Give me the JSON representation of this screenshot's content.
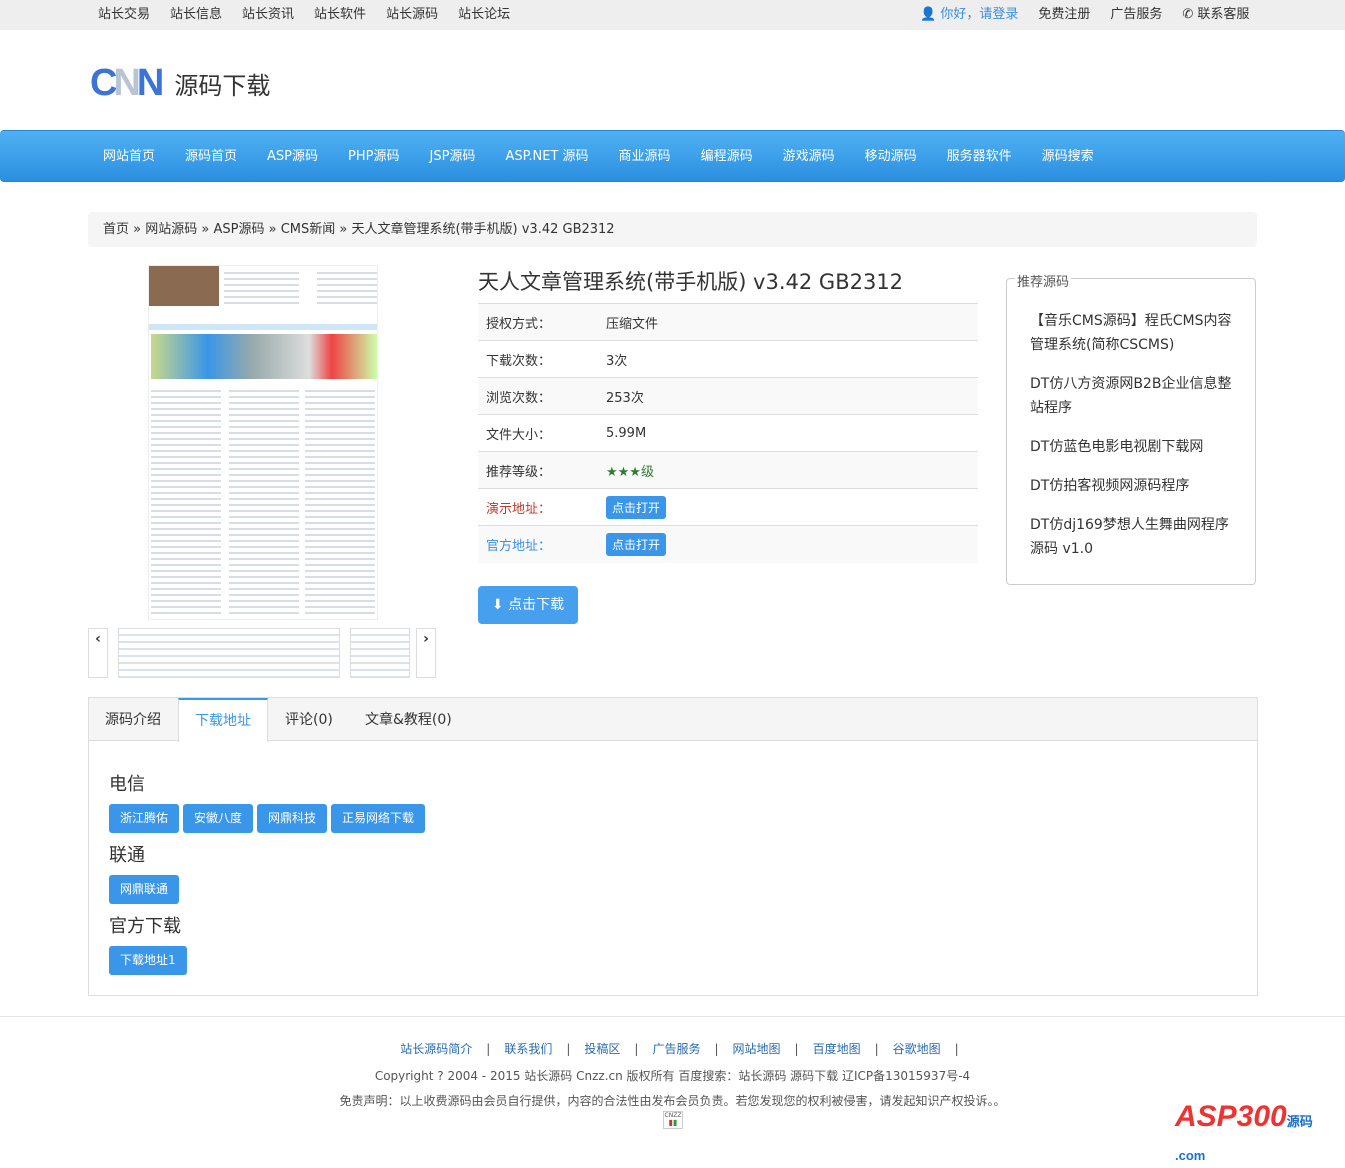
{
  "topbar": {
    "links": [
      "站长交易",
      "站长信息",
      "站长资讯",
      "站长软件",
      "站长源码",
      "站长论坛"
    ],
    "login": "你好，请登录",
    "register": "免费注册",
    "ads": "广告服务",
    "contact": "联系客服"
  },
  "logo": {
    "mark": "CNN",
    "text": "源码下载"
  },
  "nav": [
    "网站首页",
    "源码首页",
    "ASP源码",
    "PHP源码",
    "JSP源码",
    "ASP.NET 源码",
    "商业源码",
    "编程源码",
    "游戏源码",
    "移动源码",
    "服务器软件",
    "源码搜索"
  ],
  "breadcrumb": [
    "首页",
    "网站源码",
    "ASP源码",
    "CMS新闻",
    "天人文章管理系统(带手机版) v3.42 GB2312"
  ],
  "product": {
    "title": "天人文章管理系统(带手机版) v3.42 GB2312",
    "rows": [
      {
        "k": "授权方式：",
        "v": "压缩文件"
      },
      {
        "k": "下载次数：",
        "v": "3次"
      },
      {
        "k": "浏览次数：",
        "v": "253次"
      },
      {
        "k": "文件大小：",
        "v": "5.99M"
      },
      {
        "k": "推荐等级：",
        "v": "★★★级"
      },
      {
        "k": "演示地址：",
        "v": "点击打开"
      },
      {
        "k": "官方地址：",
        "v": "点击打开"
      }
    ],
    "download": "点击下载"
  },
  "sidebar": {
    "legend": "推荐源码",
    "items": [
      "【音乐CMS源码】程氏CMS内容管理系统(简称CSCMS)",
      "DT仿八方资源网B2B企业信息整站程序",
      "DT仿蓝色电影电视剧下载网",
      "DT仿拍客视频网源码程序",
      "DT仿dj169梦想人生舞曲网程序源码 v1.0"
    ]
  },
  "tabs": [
    "源码介绍",
    "下载地址",
    "评论(0)",
    "文章&教程(0)"
  ],
  "downloads": [
    {
      "name": "电信",
      "links": [
        "浙江腾佑",
        "安徽八度",
        "网鼎科技",
        "正易网络下载"
      ]
    },
    {
      "name": "联通",
      "links": [
        "网鼎联通"
      ]
    },
    {
      "name": "官方下载",
      "links": [
        "下载地址1"
      ]
    }
  ],
  "footer": {
    "links": [
      "站长源码简介",
      "联系我们",
      "投稿区",
      "广告服务",
      "网站地图",
      "百度地图",
      "谷歌地图"
    ],
    "copyright": "Copyright ? 2004 - 2015 站长源码 Cnzz.cn 版权所有 百度搜索：站长源码 源码下载 辽ICP备13015937号-4",
    "disclaimer": "免责声明：以上收费源码由会员自行提供，内容的合法性由发布会员负责。若您发现您的权利被侵害，请发起知识产权投诉。。",
    "cnzz": "CNZZ",
    "watermark": "ASP300",
    "watermark_sub": "源码 .com"
  },
  "colors": {
    "accent": "#3a96e8",
    "demo_label": "#c0392b",
    "official_label": "#3a8ee6",
    "stars": "#2e7d32"
  }
}
